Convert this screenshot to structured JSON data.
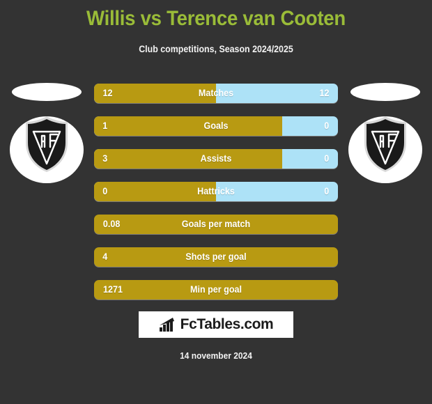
{
  "header": {
    "title": "Willis vs Terence van Cooten",
    "subtitle": "Club competitions, Season 2024/2025",
    "title_color": "#9ABC38"
  },
  "colors": {
    "background": "#333333",
    "home_bar": "#B89A12",
    "away_bar": "#ADE2F7",
    "text": "#FFFFFF",
    "accent": "#9ABC38"
  },
  "crests": {
    "home": {
      "name": "club-crest-home",
      "alt": "AFC shield crest"
    },
    "away": {
      "name": "club-crest-away",
      "alt": "AFC shield crest"
    }
  },
  "chart_data": {
    "type": "bar",
    "title": "Willis vs Terence van Cooten",
    "subtitle": "Club competitions, Season 2024/2025",
    "orientation": "horizontal-diverging",
    "categories": [
      "Matches",
      "Goals",
      "Assists",
      "Hattricks",
      "Goals per match",
      "Shots per goal",
      "Min per goal"
    ],
    "series": [
      {
        "name": "Willis",
        "values": [
          12,
          1,
          3,
          0,
          0.08,
          4,
          1271
        ]
      },
      {
        "name": "Terence van Cooten",
        "values": [
          12,
          0,
          0,
          0,
          null,
          null,
          null
        ]
      }
    ],
    "rows": [
      {
        "label": "Matches",
        "home": "12",
        "away": "12",
        "home_pct": 50,
        "comparative": true
      },
      {
        "label": "Goals",
        "home": "1",
        "away": "0",
        "home_pct": 77,
        "comparative": true
      },
      {
        "label": "Assists",
        "home": "3",
        "away": "0",
        "home_pct": 77,
        "comparative": true
      },
      {
        "label": "Hattricks",
        "home": "0",
        "away": "0",
        "home_pct": 50,
        "comparative": true
      },
      {
        "label": "Goals per match",
        "home": "0.08",
        "away": "",
        "home_pct": 100,
        "comparative": false
      },
      {
        "label": "Shots per goal",
        "home": "4",
        "away": "",
        "home_pct": 100,
        "comparative": false
      },
      {
        "label": "Min per goal",
        "home": "1271",
        "away": "",
        "home_pct": 100,
        "comparative": false
      }
    ],
    "legend": [
      "Willis",
      "Terence van Cooten"
    ],
    "grid": false
  },
  "footer": {
    "brand": "FcTables.com",
    "brand_icon": "bar-chart-icon",
    "date": "14 november 2024"
  }
}
